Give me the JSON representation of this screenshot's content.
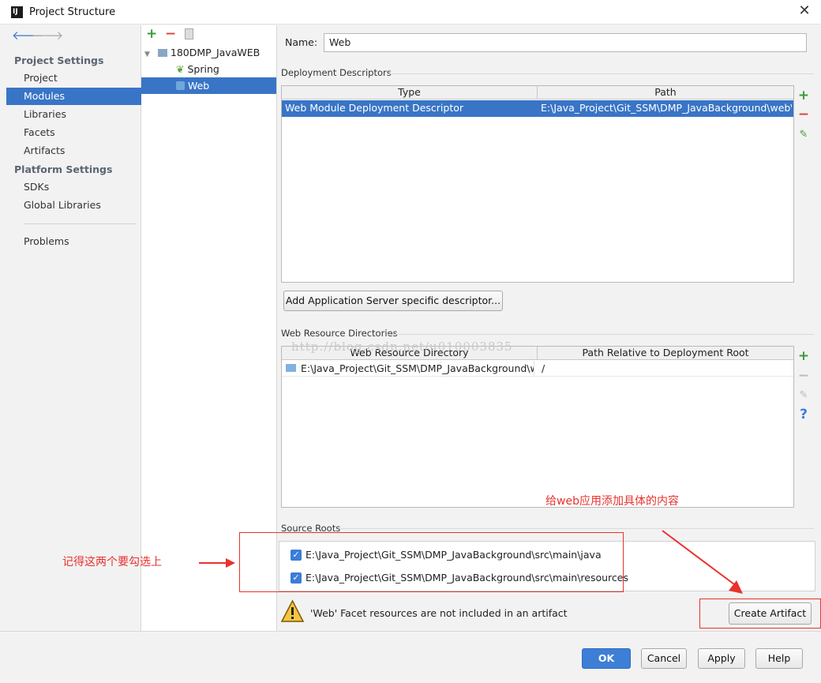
{
  "window": {
    "title": "Project Structure",
    "close": "✕"
  },
  "nav": {
    "project_settings": "Project Settings",
    "items_top": [
      "Project",
      "Modules",
      "Libraries",
      "Facets",
      "Artifacts"
    ],
    "platform_settings": "Platform Settings",
    "items_platform": [
      "SDKs",
      "Global Libraries"
    ],
    "problems": "Problems",
    "selected": "Modules"
  },
  "tree": {
    "root": "180DMP_JavaWEB",
    "children": [
      "Spring",
      "Web"
    ],
    "selected": "Web"
  },
  "form": {
    "name_label": "Name:",
    "name_value": "Web"
  },
  "deployment": {
    "section": "Deployment Descriptors",
    "columns": [
      "Type",
      "Path"
    ],
    "rows": [
      [
        "Web Module Deployment Descriptor",
        "E:\\Java_Project\\Git_SSM\\DMP_JavaBackground\\web\\WE"
      ]
    ],
    "add_button": "Add Application Server specific descriptor..."
  },
  "resources": {
    "section": "Web Resource Directories",
    "columns": [
      "Web Resource Directory",
      "Path Relative to Deployment Root"
    ],
    "rows": [
      [
        "E:\\Java_Project\\Git_SSM\\DMP_JavaBackground\\w...",
        "/"
      ]
    ],
    "watermark": "http://blog.csdn.net/u010003835"
  },
  "source_roots": {
    "section": "Source Roots",
    "items": [
      "E:\\Java_Project\\Git_SSM\\DMP_JavaBackground\\src\\main\\java",
      "E:\\Java_Project\\Git_SSM\\DMP_JavaBackground\\src\\main\\resources"
    ]
  },
  "warning": {
    "text": "'Web' Facet resources are not included in an artifact",
    "button": "Create Artifact"
  },
  "annotations": {
    "left_note": "记得这两个要勾选上",
    "right_note": "给web应用添加具体的内容"
  },
  "buttons": {
    "ok": "OK",
    "cancel": "Cancel",
    "apply": "Apply",
    "help": "Help"
  },
  "colors": {
    "selection": "#3975c6",
    "annotation_red": "#e8322d",
    "add_green": "#3c9b3c",
    "remove_red": "#d9453a"
  }
}
